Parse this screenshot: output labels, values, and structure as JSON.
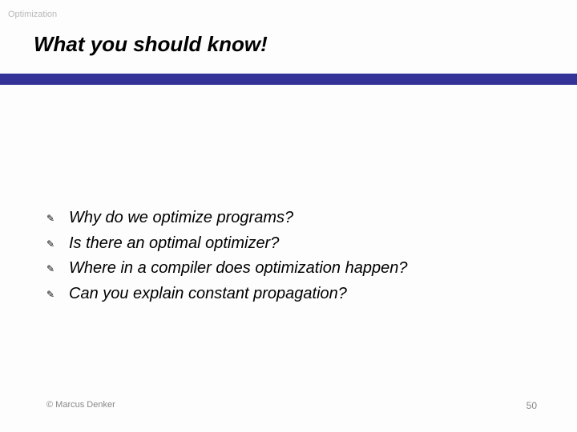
{
  "topic": "Optimization",
  "title": "What you should know!",
  "bullets": [
    "Why do we optimize programs?",
    "Is there an optimal optimizer?",
    "Where in a compiler does optimization happen?",
    "Can you explain constant propagation?"
  ],
  "footer": {
    "copyright": "© Marcus Denker",
    "page": "50"
  },
  "icons": {
    "pencil": "✎"
  }
}
